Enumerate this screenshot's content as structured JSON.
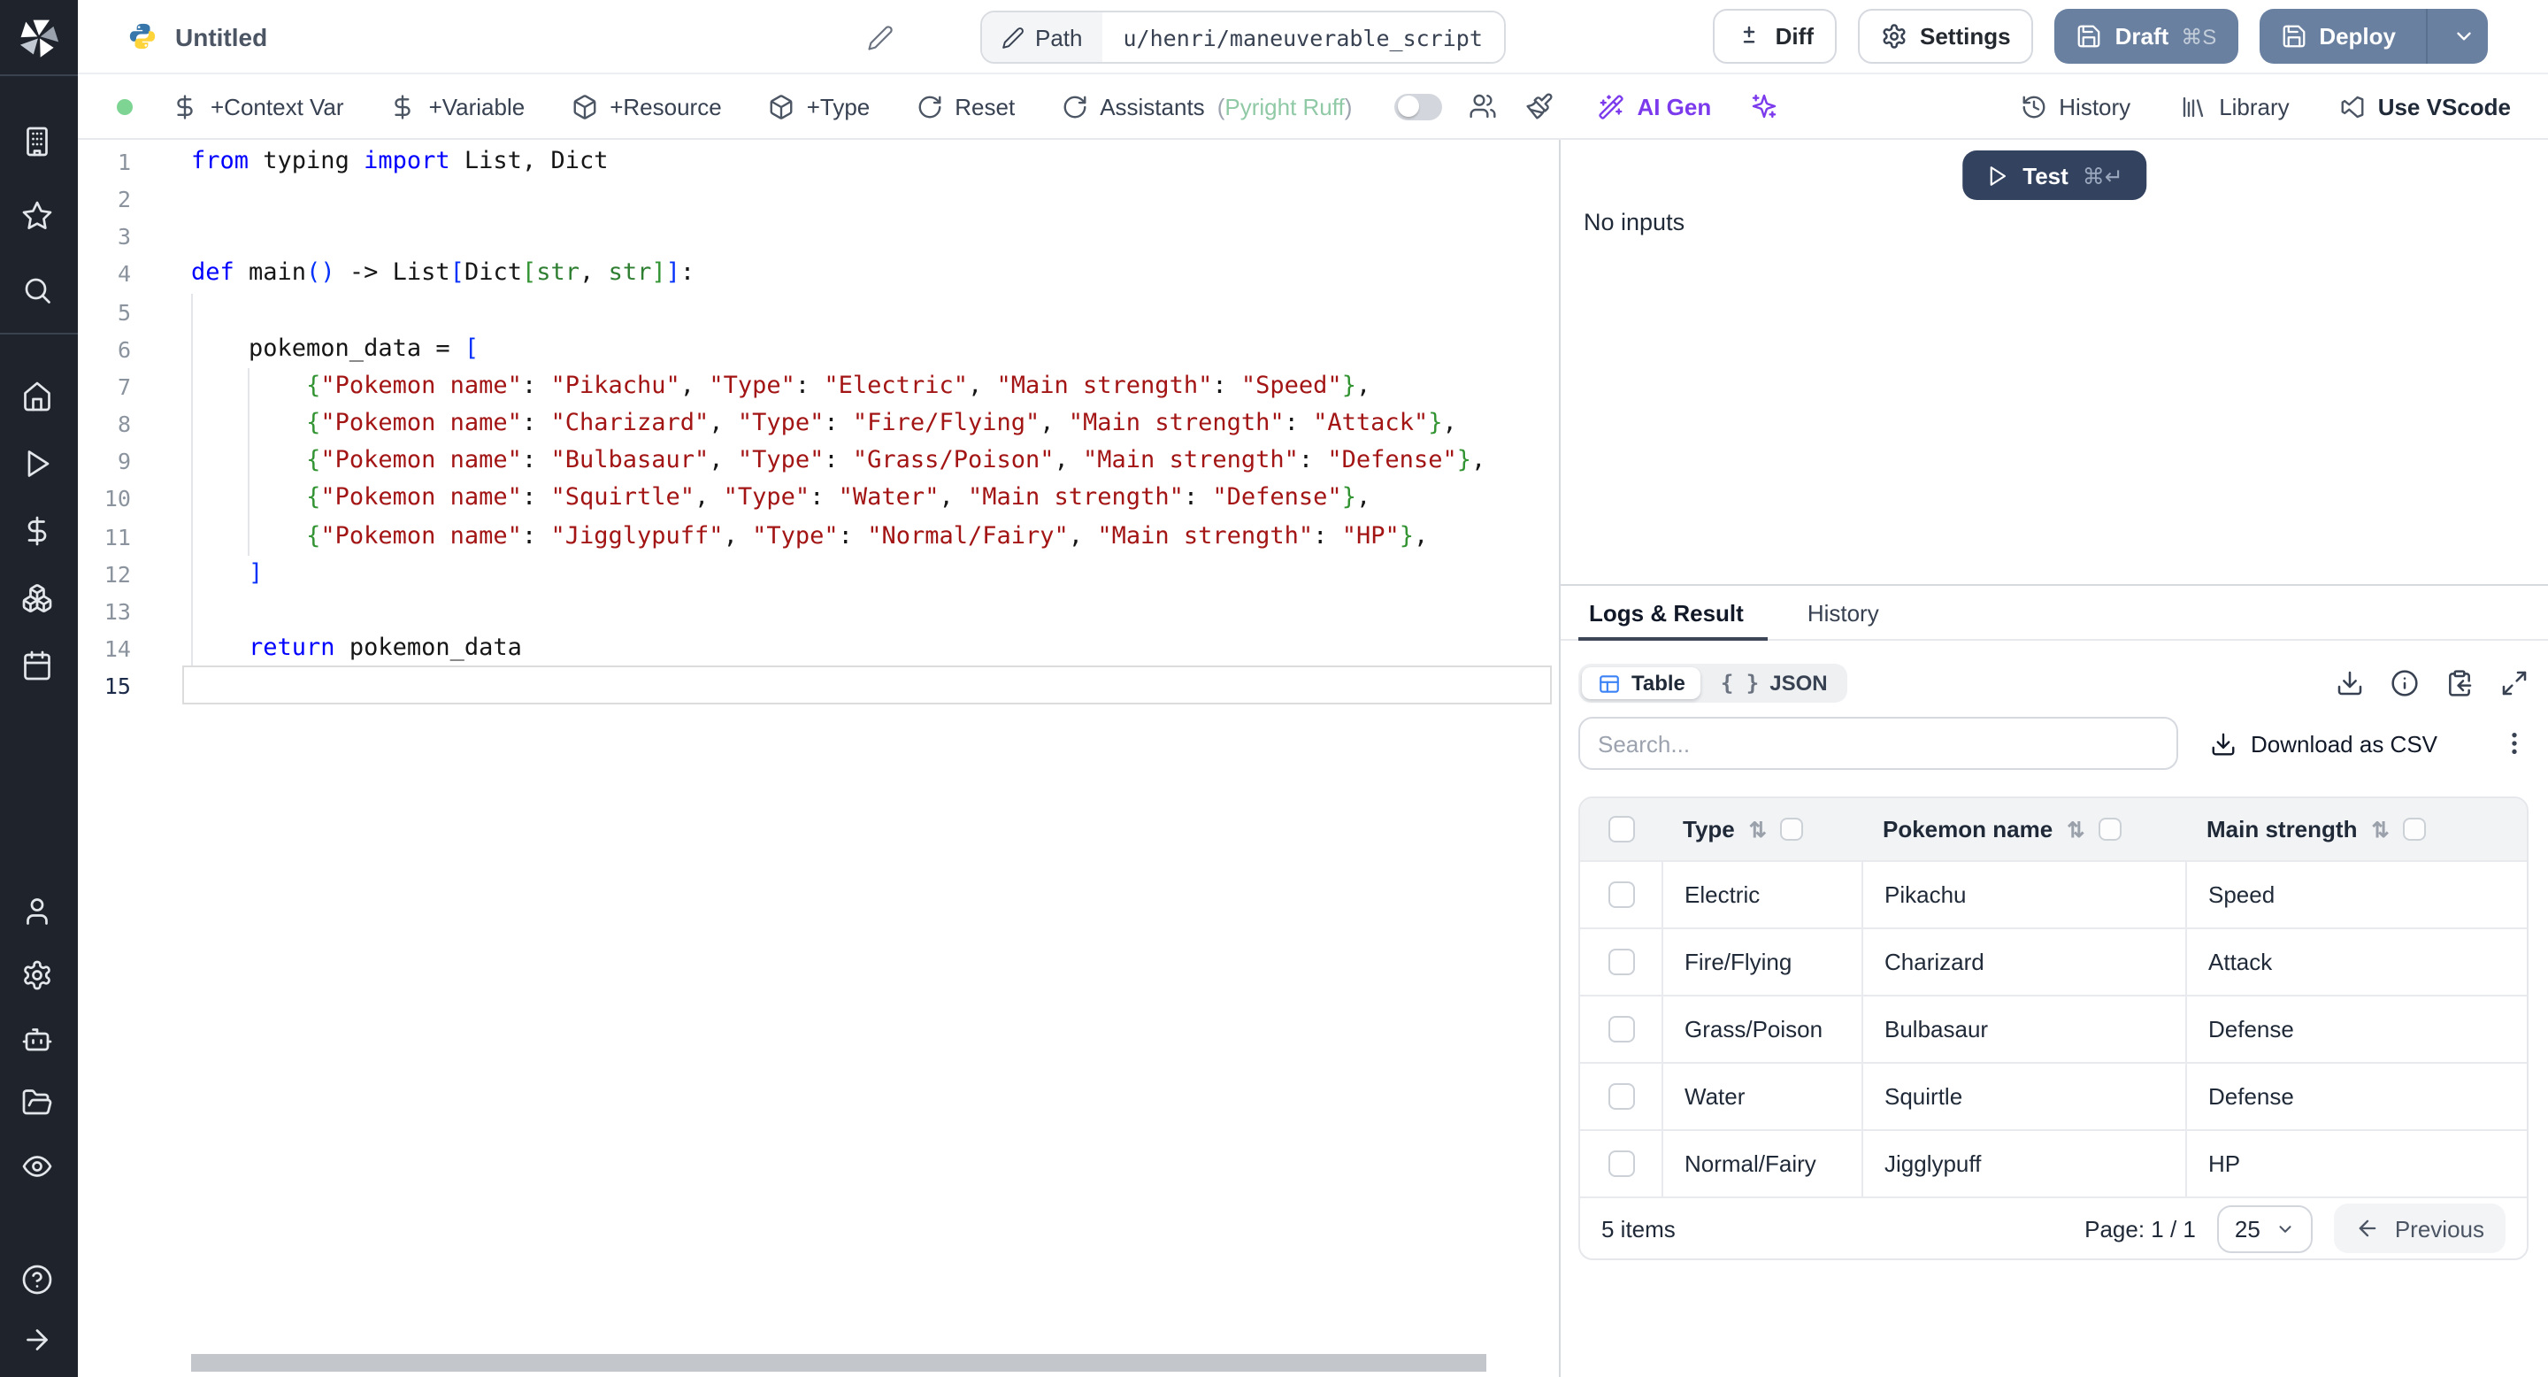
{
  "header": {
    "title": "Untitled",
    "path": {
      "label": "Path",
      "value": "u/henri/maneuverable_script"
    },
    "buttons": {
      "diff": "Diff",
      "settings": "Settings",
      "draft": "Draft",
      "draft_shortcut": "⌘S",
      "deploy": "Deploy"
    }
  },
  "toolbar": {
    "items": [
      {
        "icon": "dollar-icon",
        "label": "+Context Var",
        "name": "add-context-var-button"
      },
      {
        "icon": "dollar-icon",
        "label": "+Variable",
        "name": "add-variable-button"
      },
      {
        "icon": "package-icon",
        "label": "+Resource",
        "name": "add-resource-button"
      },
      {
        "icon": "package-icon",
        "label": "+Type",
        "name": "add-type-button"
      },
      {
        "icon": "reset-icon",
        "label": "Reset",
        "name": "reset-button"
      }
    ],
    "assistants": {
      "label": "Assistants",
      "paren_open": "(",
      "lint": "Pyright Ruff",
      "paren_close": ")"
    },
    "ai_gen_label": "AI Gen",
    "right": [
      {
        "icon": "history-icon",
        "label": "History",
        "name": "history-button"
      },
      {
        "icon": "library-icon",
        "label": "Library",
        "name": "library-button"
      },
      {
        "icon": "vscode-icon",
        "label": "Use VScode",
        "name": "use-vscode-button"
      }
    ]
  },
  "sidebar": {
    "top": [
      "building-icon",
      "star-icon",
      "search-icon"
    ],
    "middle": [
      "home-icon",
      "play-icon",
      "dollar-icon",
      "boxes-icon",
      "calendar-icon"
    ],
    "lower": [
      "user-icon",
      "gear-icon",
      "bot-icon",
      "folder-open-icon",
      "eye-icon"
    ],
    "footer": [
      "help-icon",
      "arrow-right-icon"
    ]
  },
  "editor": {
    "language": "python",
    "active_line": 15,
    "lines": [
      {
        "n": 1,
        "t": [
          [
            "kw",
            "from"
          ],
          [
            "pl",
            " typing "
          ],
          [
            "kw",
            "import"
          ],
          [
            "pl",
            " List, Dict"
          ]
        ]
      },
      {
        "n": 2,
        "t": []
      },
      {
        "n": 3,
        "t": []
      },
      {
        "n": 4,
        "t": [
          [
            "kw",
            "def"
          ],
          [
            "pl",
            " main"
          ],
          [
            "b1",
            "()"
          ],
          [
            "pl",
            " -> List"
          ],
          [
            "b1",
            "["
          ],
          [
            "pl",
            "Dict"
          ],
          [
            "b2",
            "["
          ],
          [
            "ty",
            "str"
          ],
          [
            "pl",
            ", "
          ],
          [
            "ty",
            "str"
          ],
          [
            "b2",
            "]"
          ],
          [
            "b1",
            "]"
          ],
          [
            "pl",
            ":"
          ]
        ]
      },
      {
        "n": 5,
        "t": []
      },
      {
        "n": 6,
        "t": [
          [
            "pl",
            "    pokemon_data = "
          ],
          [
            "b1",
            "["
          ]
        ]
      },
      {
        "n": 7,
        "t": [
          [
            "pl",
            "        "
          ],
          [
            "b2",
            "{"
          ],
          [
            "st",
            "\"Pokemon name\""
          ],
          [
            "pl",
            ": "
          ],
          [
            "st",
            "\"Pikachu\""
          ],
          [
            "pl",
            ", "
          ],
          [
            "st",
            "\"Type\""
          ],
          [
            "pl",
            ": "
          ],
          [
            "st",
            "\"Electric\""
          ],
          [
            "pl",
            ", "
          ],
          [
            "st",
            "\"Main strength\""
          ],
          [
            "pl",
            ": "
          ],
          [
            "st",
            "\"Speed\""
          ],
          [
            "b2",
            "}"
          ],
          [
            "pl",
            ","
          ]
        ]
      },
      {
        "n": 8,
        "t": [
          [
            "pl",
            "        "
          ],
          [
            "b2",
            "{"
          ],
          [
            "st",
            "\"Pokemon name\""
          ],
          [
            "pl",
            ": "
          ],
          [
            "st",
            "\"Charizard\""
          ],
          [
            "pl",
            ", "
          ],
          [
            "st",
            "\"Type\""
          ],
          [
            "pl",
            ": "
          ],
          [
            "st",
            "\"Fire/Flying\""
          ],
          [
            "pl",
            ", "
          ],
          [
            "st",
            "\"Main strength\""
          ],
          [
            "pl",
            ": "
          ],
          [
            "st",
            "\"Attack\""
          ],
          [
            "b2",
            "}"
          ],
          [
            "pl",
            ","
          ]
        ]
      },
      {
        "n": 9,
        "t": [
          [
            "pl",
            "        "
          ],
          [
            "b2",
            "{"
          ],
          [
            "st",
            "\"Pokemon name\""
          ],
          [
            "pl",
            ": "
          ],
          [
            "st",
            "\"Bulbasaur\""
          ],
          [
            "pl",
            ", "
          ],
          [
            "st",
            "\"Type\""
          ],
          [
            "pl",
            ": "
          ],
          [
            "st",
            "\"Grass/Poison\""
          ],
          [
            "pl",
            ", "
          ],
          [
            "st",
            "\"Main strength\""
          ],
          [
            "pl",
            ": "
          ],
          [
            "st",
            "\"Defense\""
          ],
          [
            "b2",
            "}"
          ],
          [
            "pl",
            ","
          ]
        ]
      },
      {
        "n": 10,
        "t": [
          [
            "pl",
            "        "
          ],
          [
            "b2",
            "{"
          ],
          [
            "st",
            "\"Pokemon name\""
          ],
          [
            "pl",
            ": "
          ],
          [
            "st",
            "\"Squirtle\""
          ],
          [
            "pl",
            ", "
          ],
          [
            "st",
            "\"Type\""
          ],
          [
            "pl",
            ": "
          ],
          [
            "st",
            "\"Water\""
          ],
          [
            "pl",
            ", "
          ],
          [
            "st",
            "\"Main strength\""
          ],
          [
            "pl",
            ": "
          ],
          [
            "st",
            "\"Defense\""
          ],
          [
            "b2",
            "}"
          ],
          [
            "pl",
            ","
          ]
        ]
      },
      {
        "n": 11,
        "t": [
          [
            "pl",
            "        "
          ],
          [
            "b2",
            "{"
          ],
          [
            "st",
            "\"Pokemon name\""
          ],
          [
            "pl",
            ": "
          ],
          [
            "st",
            "\"Jigglypuff\""
          ],
          [
            "pl",
            ", "
          ],
          [
            "st",
            "\"Type\""
          ],
          [
            "pl",
            ": "
          ],
          [
            "st",
            "\"Normal/Fairy\""
          ],
          [
            "pl",
            ", "
          ],
          [
            "st",
            "\"Main strength\""
          ],
          [
            "pl",
            ": "
          ],
          [
            "st",
            "\"HP\""
          ],
          [
            "b2",
            "}"
          ],
          [
            "pl",
            ","
          ]
        ]
      },
      {
        "n": 12,
        "t": [
          [
            "pl",
            "    "
          ],
          [
            "b1",
            "]"
          ]
        ]
      },
      {
        "n": 13,
        "t": []
      },
      {
        "n": 14,
        "t": [
          [
            "pl",
            "    "
          ],
          [
            "kw",
            "return"
          ],
          [
            "pl",
            " pokemon_data"
          ]
        ]
      },
      {
        "n": 15,
        "t": []
      }
    ]
  },
  "run": {
    "test_label": "Test",
    "test_shortcut": "⌘↵",
    "no_inputs": "No inputs"
  },
  "result_panel": {
    "tabs": [
      {
        "label": "Logs & Result",
        "active": true
      },
      {
        "label": "History",
        "active": false
      }
    ],
    "view_toggle": [
      {
        "label": "Table",
        "icon": "table-icon",
        "active": true
      },
      {
        "label": "JSON",
        "icon_glyph": "{ }",
        "active": false
      }
    ],
    "search_placeholder": "Search...",
    "download_csv_label": "Download as CSV",
    "sort_glyph": "⇅",
    "table": {
      "columns": [
        "Type",
        "Pokemon name",
        "Main strength"
      ],
      "rows": [
        [
          "Electric",
          "Pikachu",
          "Speed"
        ],
        [
          "Fire/Flying",
          "Charizard",
          "Attack"
        ],
        [
          "Grass/Poison",
          "Bulbasaur",
          "Defense"
        ],
        [
          "Water",
          "Squirtle",
          "Defense"
        ],
        [
          "Normal/Fairy",
          "Jigglypuff",
          "HP"
        ]
      ]
    },
    "footer": {
      "items_text": "5 items",
      "page_text": "Page: 1 / 1",
      "page_size": "25",
      "previous_label": "Previous"
    }
  },
  "colors": {
    "sidebar_bg": "#1f242c",
    "primary_button": "#6a80a0",
    "test_button": "#33425f",
    "lint_green": "#8fc9a5",
    "ai_purple": "#7c3aed",
    "table_icon_blue": "#3b82f6",
    "status_dot_green": "#7ed493"
  }
}
